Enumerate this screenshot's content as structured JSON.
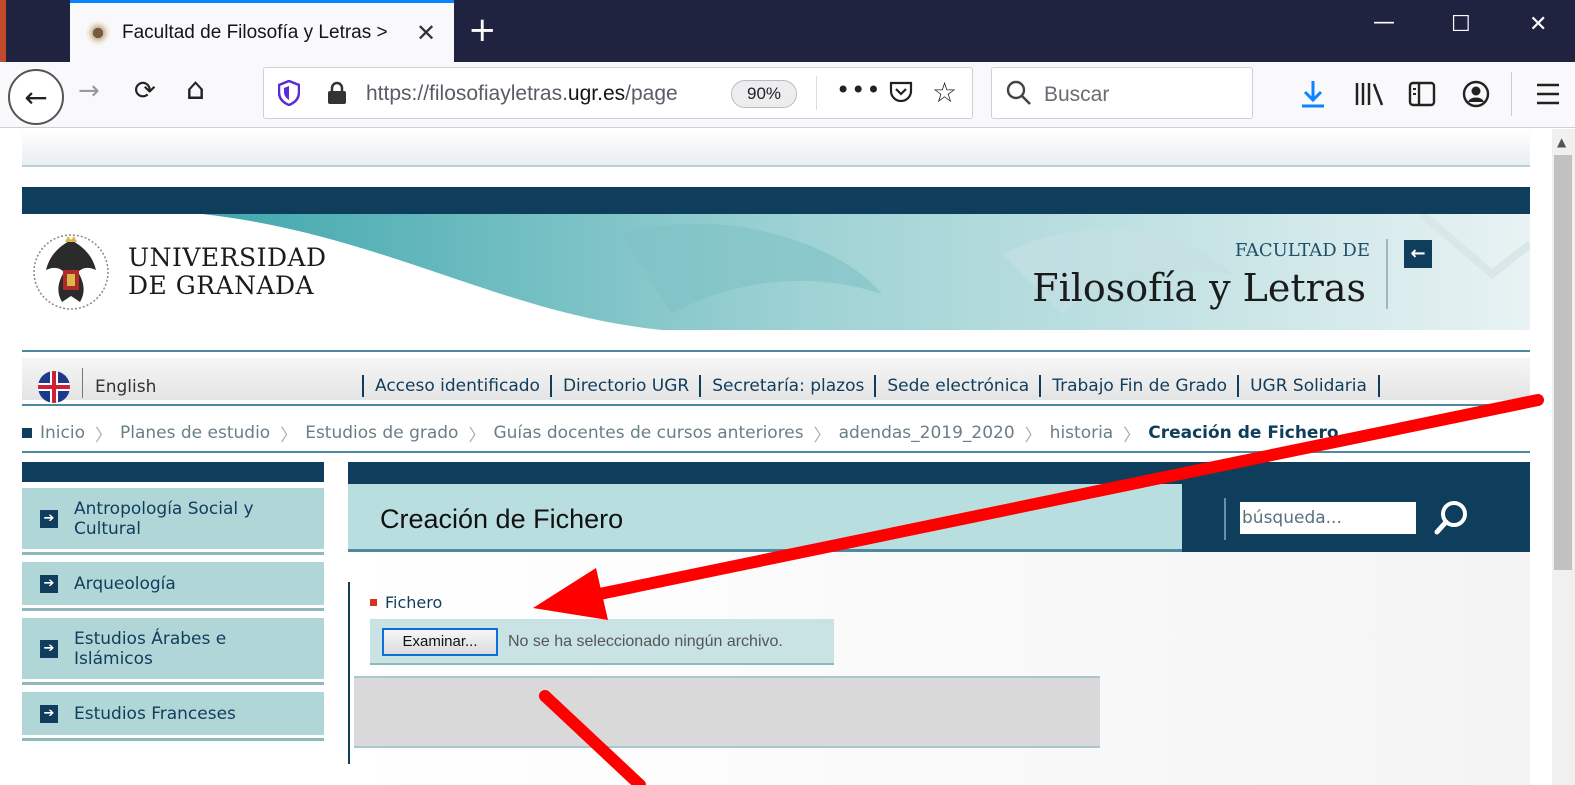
{
  "browser": {
    "tab": {
      "title": "Facultad de Filosofía y Letras >",
      "close_glyph": "✕"
    },
    "new_tab_glyph": "+",
    "window_controls": {
      "minimize": "—",
      "maximize": "☐",
      "close": "✕"
    },
    "nav": {
      "back": "←",
      "forward": "→",
      "reload": "⟳",
      "home": "⌂"
    },
    "url": {
      "prefix": "https://filosofiayletras.",
      "domain": "ugr.es",
      "suffix": "/page"
    },
    "zoom": "90%",
    "more_glyph": "•••",
    "star_glyph": "☆",
    "search": {
      "placeholder": "Buscar"
    },
    "toolbar_icons": [
      "download-icon",
      "library-icon",
      "sidebar-icon",
      "account-icon",
      "menu-icon"
    ],
    "accent_color": "#0a84ff"
  },
  "header": {
    "university_line1": "UNIVERSIDAD",
    "university_line2": "DE GRANADA",
    "faculty_small": "FACULTAD DE",
    "faculty_big": "Filosofía y Letras",
    "back_arrow": "←",
    "brand_color": "#0f3d5c"
  },
  "toplinks": {
    "language": "English",
    "items": [
      "Acceso identificado",
      "Directorio UGR",
      "Secretaría: plazos",
      "Sede electrónica",
      "Trabajo Fin de Grado",
      "UGR Solidaria"
    ]
  },
  "breadcrumb": {
    "items": [
      "Inicio",
      "Planes de estudio",
      "Estudios de grado",
      "Guías docentes de cursos anteriores",
      "adendas_2019_2020",
      "historia"
    ],
    "current": "Creación de Fichero",
    "separator": "〉"
  },
  "sidebar": {
    "items": [
      {
        "label": "Antropología Social y Cultural"
      },
      {
        "label": "Arqueología"
      },
      {
        "label": "Estudios Árabes e Islámicos"
      },
      {
        "label": "Estudios Franceses"
      }
    ],
    "arrow_glyph": "➔"
  },
  "main": {
    "title": "Creación de Fichero",
    "search_placeholder": "búsqueda...",
    "form": {
      "field_label": "Fichero",
      "browse_button": "Examinar...",
      "file_status": "No se ha seleccionado ningún archivo."
    }
  },
  "annotation": {
    "arrow_color": "#ff0000"
  }
}
